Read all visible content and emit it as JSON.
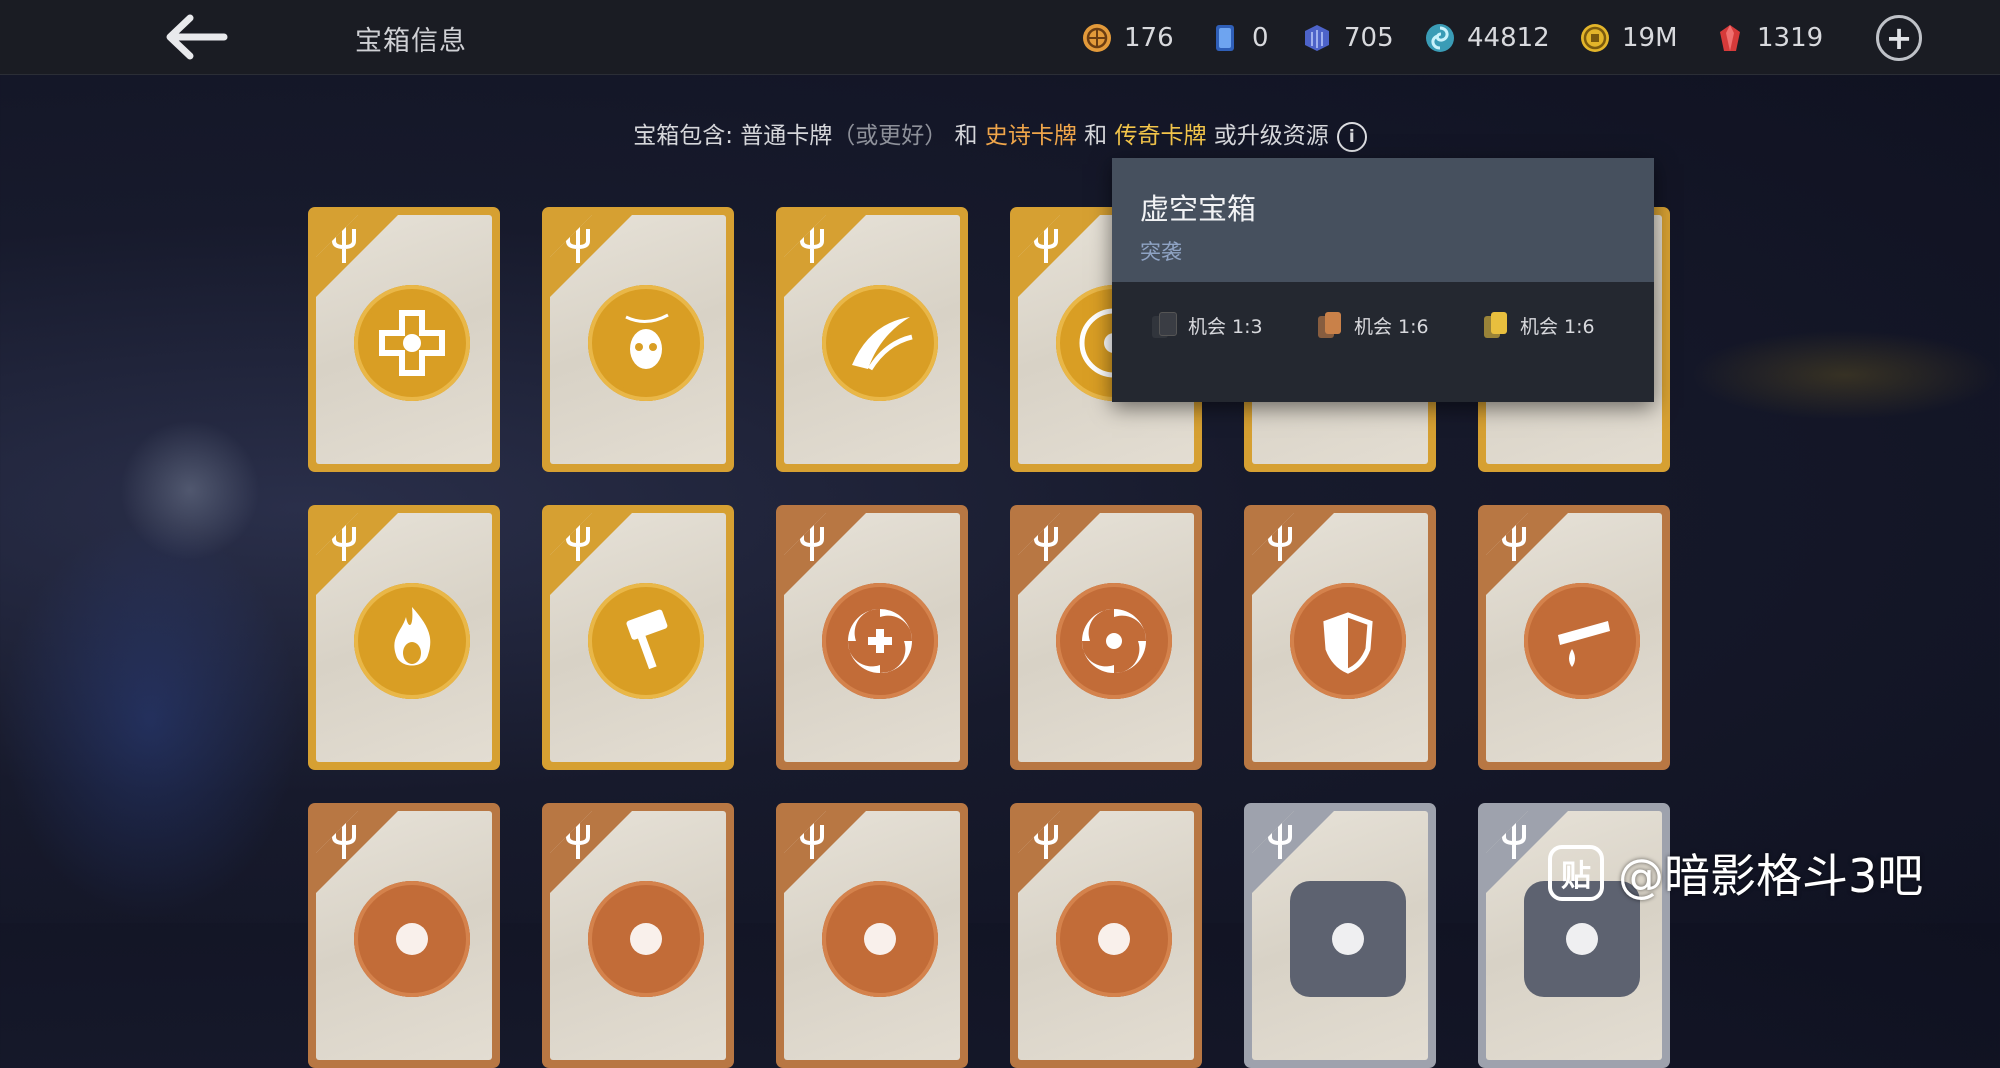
{
  "header": {
    "title": "宝箱信息",
    "resources": [
      {
        "name": "orb-coin",
        "value": "176",
        "color": "#e39a3a"
      },
      {
        "name": "blue-card",
        "value": "0",
        "color": "#3d7ee0"
      },
      {
        "name": "blue-gem",
        "value": "705",
        "color": "#4d63c9"
      },
      {
        "name": "essence",
        "value": "44812",
        "color": "#4fb6cf"
      },
      {
        "name": "gold-coin",
        "value": "19M",
        "color": "#e3b52a"
      },
      {
        "name": "ruby",
        "value": "1319",
        "color": "#d63a3a"
      }
    ]
  },
  "info": {
    "prefix": "宝箱包含: 普通卡牌",
    "muted": "（或更好）",
    "and1": " 和 ",
    "epic": "史诗卡牌",
    "and2": " 和 ",
    "legendary": "传奇卡牌",
    "suffix": " 或升级资源"
  },
  "tooltip": {
    "title": "虚空宝箱",
    "subtitle": "突袭",
    "odds": [
      {
        "label": "机会 1:3",
        "color": "#3a3d44"
      },
      {
        "label": "机会 1:6",
        "color": "#c98149"
      },
      {
        "label": "机会 1:6",
        "color": "#e8bf3e"
      }
    ]
  },
  "cards": {
    "rarity_colors": {
      "gold": "#d6a032",
      "bronze": "#b87743",
      "silver": "#9ea2ad"
    },
    "rows": [
      [
        "gold",
        "gold",
        "gold",
        "gold",
        "gold",
        "gold"
      ],
      [
        "gold",
        "gold",
        "bronze",
        "bronze",
        "bronze",
        "bronze"
      ],
      [
        "bronze",
        "bronze",
        "bronze",
        "bronze",
        "silver",
        "silver"
      ]
    ],
    "icons": [
      [
        "healing-cross-icon",
        "skull-kunai-icon",
        "slash-icon",
        "vortex-icon",
        "",
        ""
      ],
      [
        "flame-face-icon",
        "hammer-icon",
        "heal-swirl-icon",
        "swirl-icon",
        "sun-shield-icon",
        "blade-drop-icon"
      ],
      [
        "",
        "",
        "",
        "",
        "",
        ""
      ]
    ]
  },
  "watermark": {
    "logo": "贴",
    "text": "@暗影格斗3吧"
  }
}
